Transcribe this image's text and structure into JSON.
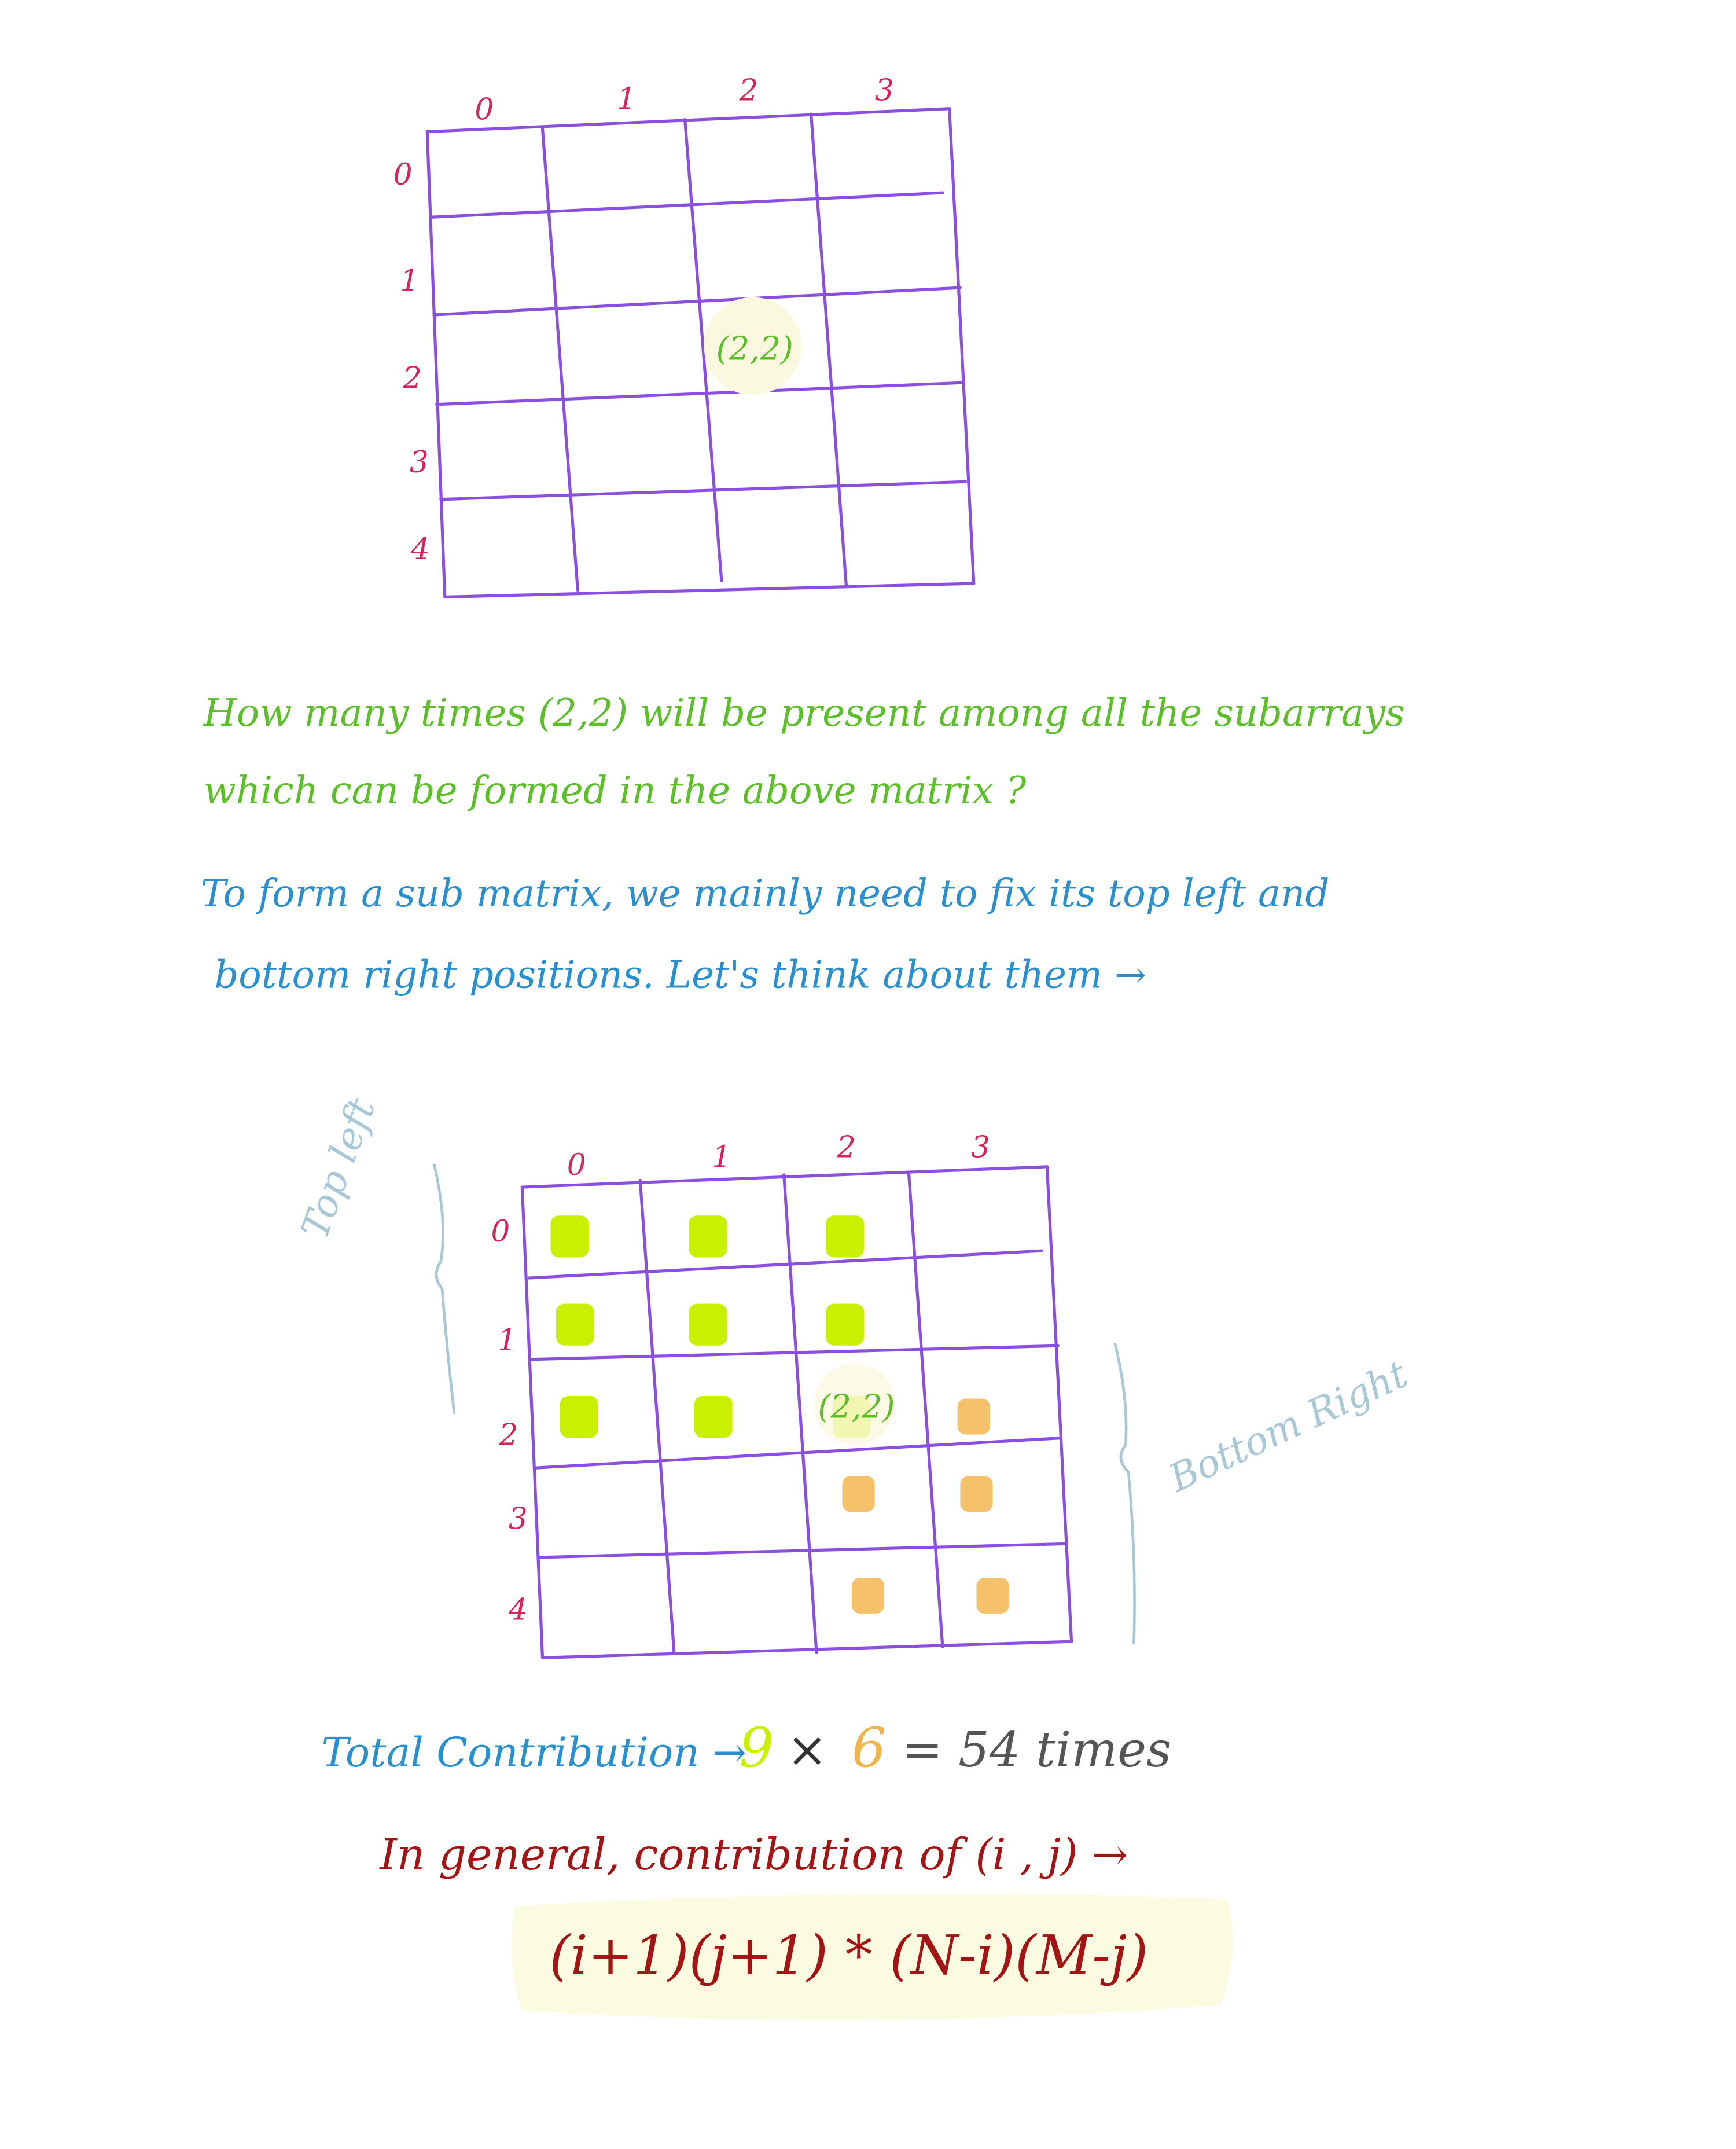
{
  "grid1": {
    "col_labels": [
      "0",
      "1",
      "2",
      "3"
    ],
    "row_labels": [
      "0",
      "1",
      "2",
      "3",
      "4"
    ],
    "highlight_cell": "(2,2)"
  },
  "question": {
    "line1": "How many times (2,2) will be present among all the subarrays",
    "line2": "which can be formed in the above matrix ?"
  },
  "explanation": {
    "line1": "To form a sub matrix, we mainly need to fix its top left and",
    "line2": "bottom right positions. Let's think about them →"
  },
  "grid2": {
    "col_labels": [
      "0",
      "1",
      "2",
      "3"
    ],
    "row_labels": [
      "0",
      "1",
      "2",
      "3",
      "4"
    ],
    "highlight_cell": "(2,2)",
    "top_left_label": "Top left",
    "bottom_right_label": "Bottom Right",
    "top_left_color": "#c8f000",
    "bottom_right_color": "#f5c26b"
  },
  "total": {
    "label": "Total Contribution →",
    "a": "9",
    "times_sign": "×",
    "b": "6",
    "equals": "= 54 times"
  },
  "general": {
    "label": "In general, contribution of (i , j) →",
    "formula": "(i+1)(j+1) * (N-i)(M-j)"
  }
}
